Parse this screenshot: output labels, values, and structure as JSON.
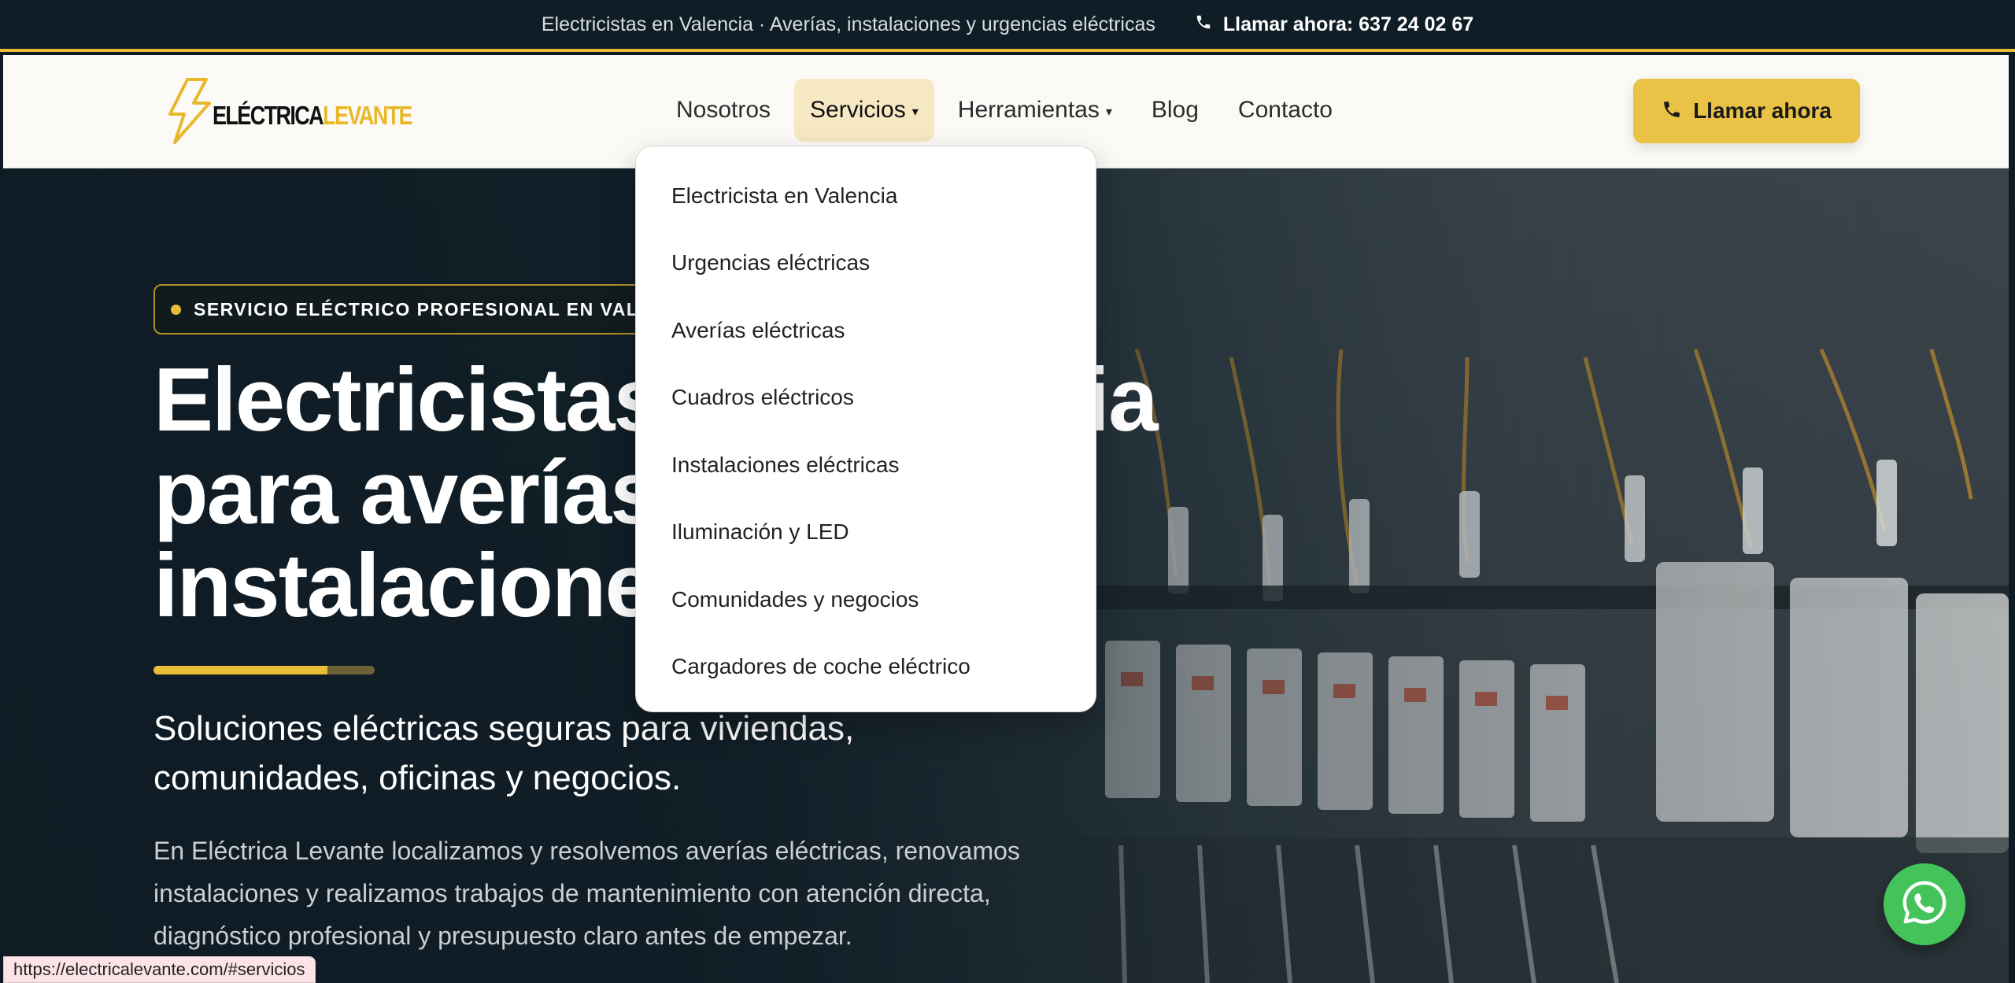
{
  "topbar": {
    "tagline": "Electricistas en Valencia · Averías, instalaciones y urgencias eléctricas",
    "call_label": "Llamar ahora: 637 24 02 67"
  },
  "header": {
    "logo": {
      "part1": "ELÉCTRICA",
      "part2": "LEVANTE"
    },
    "nav": [
      {
        "label": "Nosotros"
      },
      {
        "label": "Servicios",
        "caret": "▾",
        "active": true
      },
      {
        "label": "Herramientas",
        "caret": "▾"
      },
      {
        "label": "Blog"
      },
      {
        "label": "Contacto"
      }
    ],
    "cta_label": "Llamar ahora"
  },
  "dropdown": {
    "items": [
      "Electricista en Valencia",
      "Urgencias eléctricas",
      "Averías eléctricas",
      "Cuadros eléctricos",
      "Instalaciones eléctricas",
      "Iluminación y LED",
      "Comunidades y negocios",
      "Cargadores de coche eléctrico"
    ]
  },
  "hero": {
    "badge": "SERVICIO ELÉCTRICO PROFESIONAL EN VALENCIA",
    "title_line1": "Electricistas en Valencia",
    "title_line2": "para averías e",
    "title_line3": "instalaciones",
    "subtitle_line1": "Soluciones eléctricas seguras para viviendas,",
    "subtitle_line2": "comunidades, oficinas y negocios.",
    "body_line1": "En Eléctrica Levante localizamos y resolvemos averías eléctricas, renovamos",
    "body_line2": "instalaciones y realizamos trabajos de mantenimiento con atención directa,",
    "body_line3": "diagnóstico profesional y presupuesto claro antes de empezar."
  },
  "status_url": "https://electricalevante.com/#servicios",
  "colors": {
    "accent": "#e9bd35",
    "dark": "#0f1d26",
    "whatsapp": "#43c35a"
  },
  "icons": {
    "phone": "phone-icon",
    "whatsapp": "whatsapp-icon",
    "logo": "lightning-bolt-icon"
  }
}
